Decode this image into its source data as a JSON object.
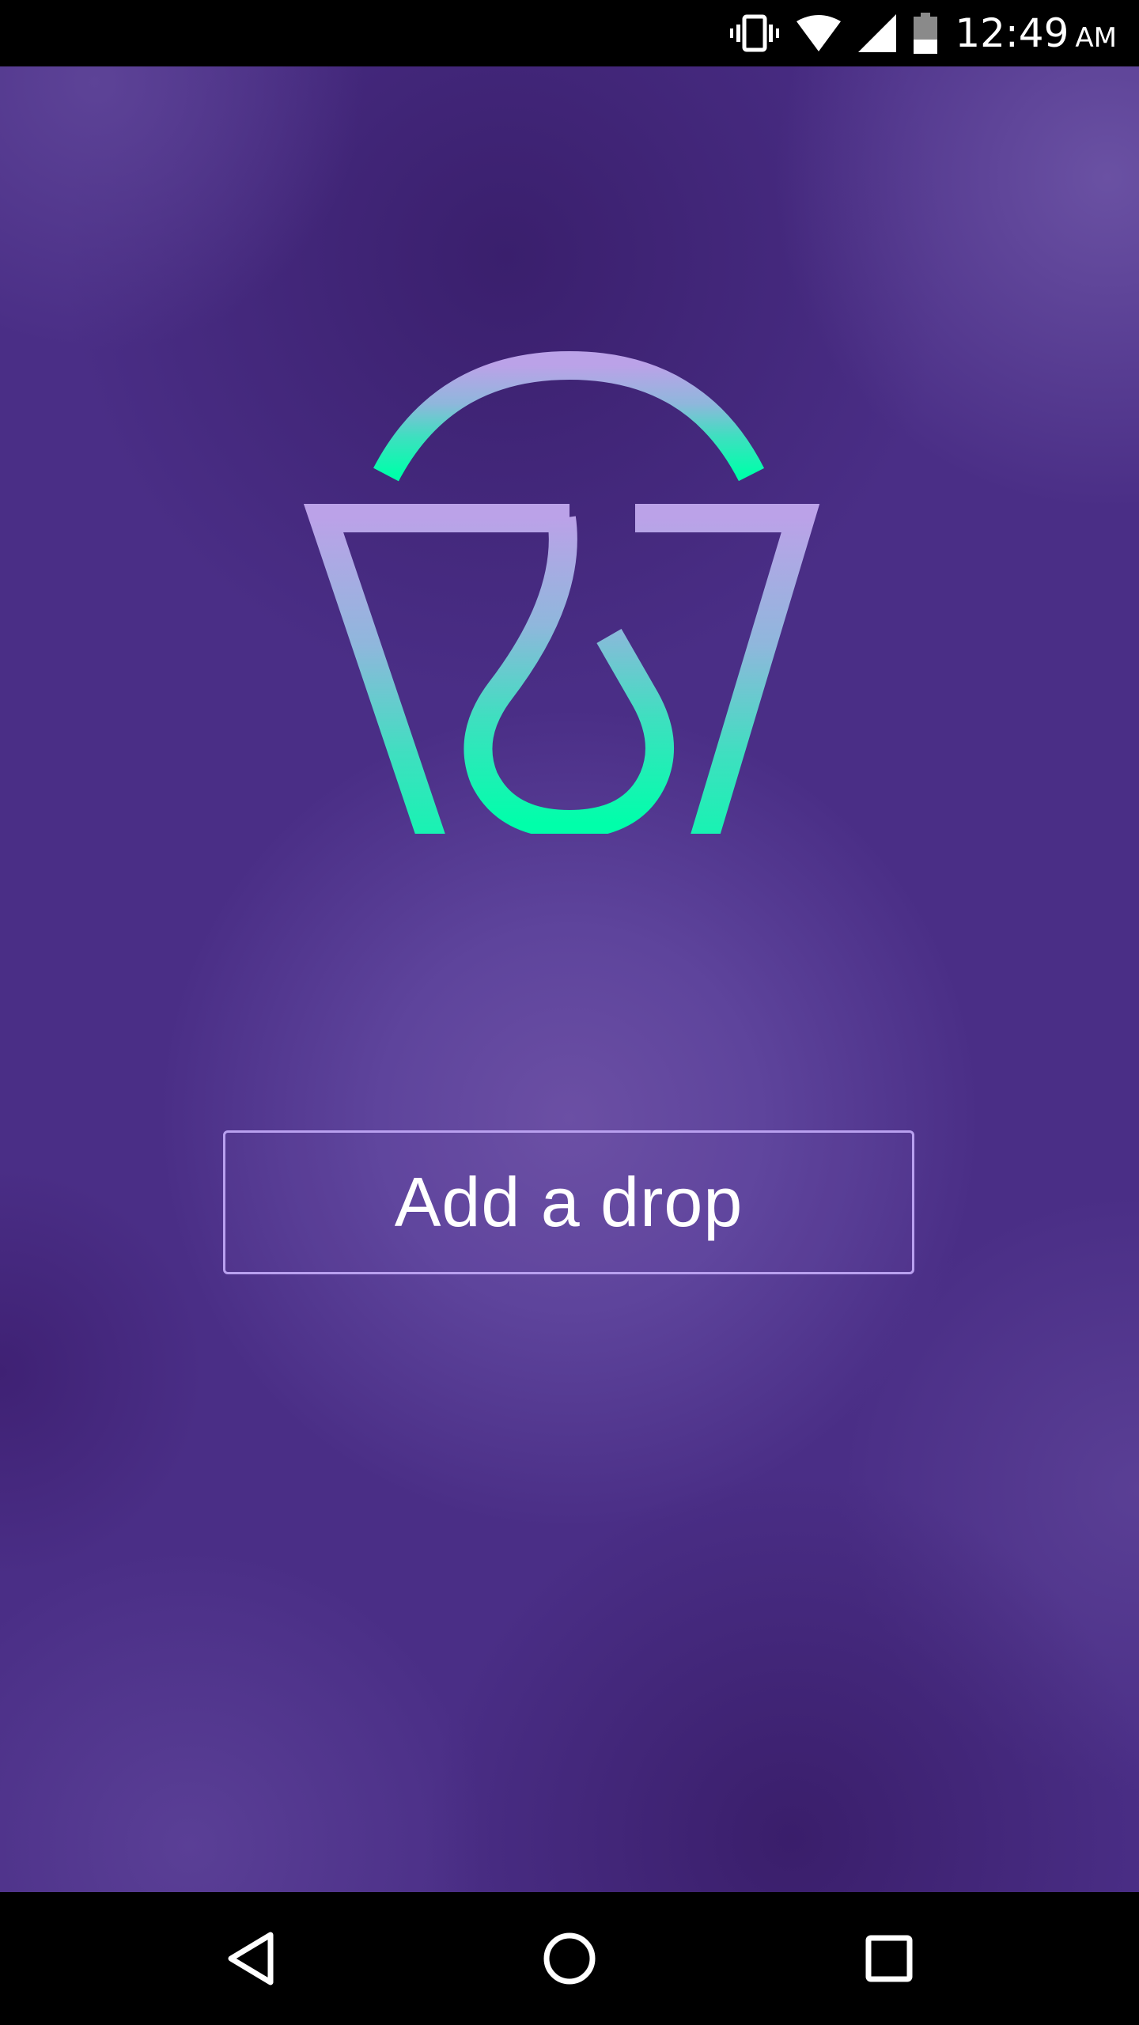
{
  "status_bar": {
    "time": "12:49",
    "ampm": "AM",
    "icons": [
      "vibrate-icon",
      "wifi-icon",
      "cell-signal-icon",
      "battery-icon"
    ]
  },
  "main": {
    "logo_icon": "bucket-drop-logo",
    "add_button_label": "Add a drop"
  },
  "nav_bar": {
    "icons": [
      "back-icon",
      "home-icon",
      "recents-icon"
    ]
  },
  "colors": {
    "background": "#4a2e86",
    "logo_gradient_top": "#b9a0e8",
    "logo_gradient_bottom": "#00ffaa",
    "button_border": "#b9a0ef",
    "button_text": "#ffffff"
  }
}
